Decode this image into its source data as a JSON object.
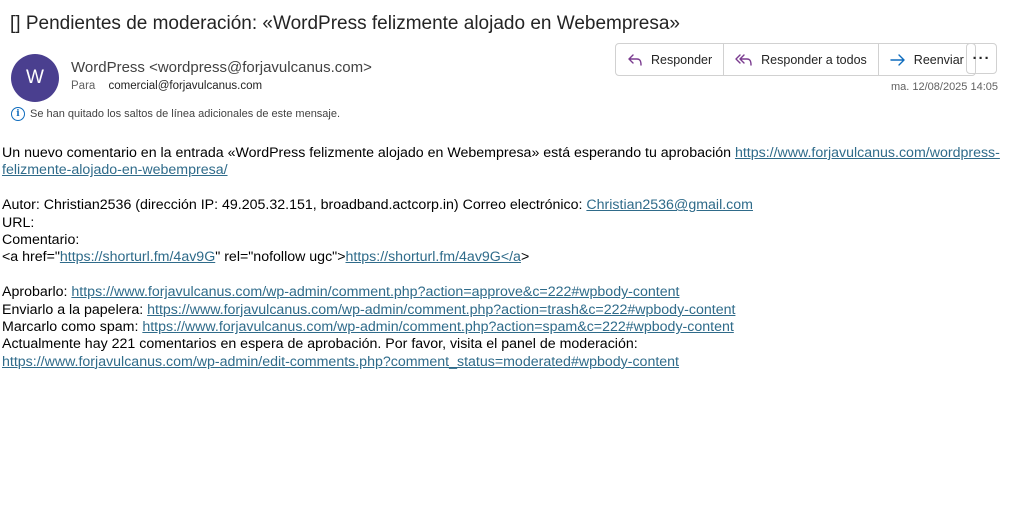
{
  "subject": "[] Pendientes de moderación: «WordPress felizmente alojado en Webempresa»",
  "avatar_letter": "W",
  "sender": "WordPress <wordpress@forjavulcanus.com>",
  "to_label": "Para",
  "to_value": "comercial@forjavulcanus.com",
  "info_text": "Se han quitado los saltos de línea adicionales de este mensaje.",
  "actions": {
    "reply": "Responder",
    "reply_all": "Responder a todos",
    "forward": "Reenviar",
    "more": "···"
  },
  "date": "ma. 12/08/2025 14:05",
  "body": {
    "intro_text": "Un nuevo comentario en la entrada «WordPress felizmente alojado en Webempresa» está esperando tu aprobación ",
    "intro_link": "https://www.forjavulcanus.com/wordpress-felizmente-alojado-en-webempresa/",
    "author_text": "Autor: Christian2536 (dirección IP: 49.205.32.151, broadband.actcorp.in) Correo electrónico: ",
    "author_email": "Christian2536@gmail.com",
    "url_label": "URL:",
    "comment_label": "Comentario:",
    "comment_pre": "<a href=\"",
    "comment_link1": "https://shorturl.fm/4av9G",
    "comment_mid": "\" rel=\"nofollow ugc\">",
    "comment_link2": "https://shorturl.fm/4av9G</a",
    "comment_post": ">",
    "approve_label": "Aprobarlo: ",
    "approve_link": "https://www.forjavulcanus.com/wp-admin/comment.php?action=approve&c=222#wpbody-content",
    "trash_label": "Enviarlo a la papelera: ",
    "trash_link": "https://www.forjavulcanus.com/wp-admin/comment.php?action=trash&c=222#wpbody-content",
    "spam_label": "Marcarlo como spam: ",
    "spam_link": "https://www.forjavulcanus.com/wp-admin/comment.php?action=spam&c=222#wpbody-content",
    "pending_text": "Actualmente hay 221 comentarios en espera de aprobación. Por favor, visita el panel de moderación:",
    "panel_link": "https://www.forjavulcanus.com/wp-admin/edit-comments.php?comment_status=moderated#wpbody-content"
  }
}
